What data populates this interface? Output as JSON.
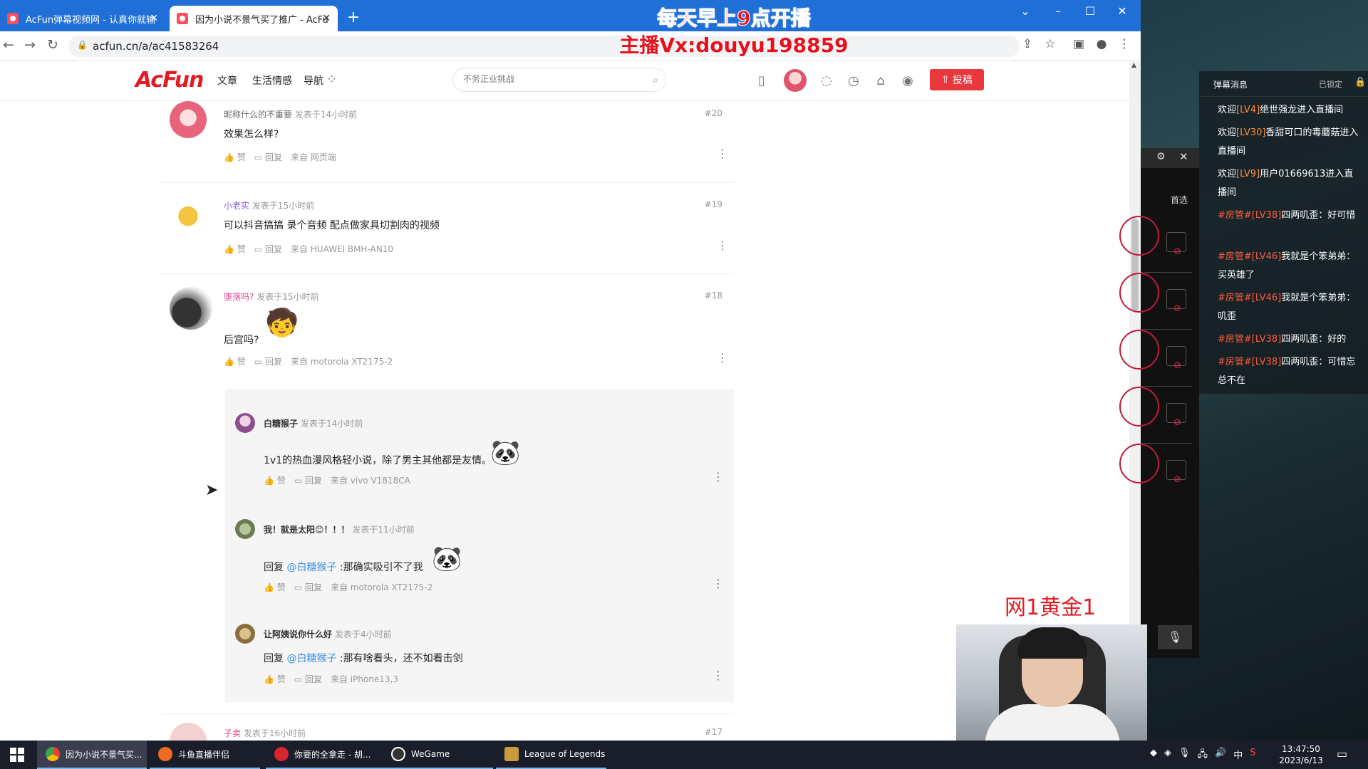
{
  "browser": {
    "tabs": [
      {
        "title": "AcFun弹幕视频网 - 认真你就输",
        "active": false
      },
      {
        "title": "因为小说不景气买了推广 - AcFu",
        "active": true
      }
    ],
    "new_tab": "+",
    "url": "acfun.cn/a/ac41583264",
    "window_controls": {
      "chevron": "⌄",
      "minimize": "–",
      "maximize": "☐",
      "close": "✕"
    }
  },
  "stream_overlay": {
    "line1": "每天早上9点开播",
    "line2": "主播Vx:douyu198859",
    "rank": "网1黄金1"
  },
  "site": {
    "logo": "AcFun",
    "nav": [
      "文章",
      "生活情感",
      "导航"
    ],
    "search_placeholder": "不务正业挑战",
    "upload_label": "投稿"
  },
  "comments": [
    {
      "name": "昵称什么的不重要",
      "time": "发表于14小时前",
      "num": "#20",
      "text": "效果怎么样?",
      "like": "赞",
      "reply": "回复",
      "source": "来自 网页端"
    },
    {
      "name": "小老实",
      "time": "发表于15小时前",
      "num": "#19",
      "text": "可以抖音搞搞  录个音频  配点做家具切割肉的视频",
      "like": "赞",
      "reply": "回复",
      "source": "来自 HUAWEI  BMH-AN10"
    },
    {
      "name": "堕落吗?",
      "time": "发表于15小时前",
      "num": "#18",
      "text": "后宫吗?",
      "like": "赞",
      "reply": "回复",
      "source": "来自 motorola  XT2175-2"
    },
    {
      "name": "子卖",
      "time": "发表于16小时前",
      "num": "#17"
    }
  ],
  "replies": [
    {
      "name": "白糖猴子",
      "time": "发表于14小时前",
      "prefix": "",
      "at": "",
      "text": "1v1的热血漫风格轻小说，除了男主其他都是友情。",
      "like": "赞",
      "reply": "回复",
      "source": "来自 vivo  V1818CA"
    },
    {
      "name": "我！就是太阳😊！！！",
      "time": "发表于11小时前",
      "prefix": "回复",
      "at": "@白糖猴子",
      "text": ":那确实吸引不了我",
      "like": "赞",
      "reply": "回复",
      "source": "来自 motorola  XT2175-2"
    },
    {
      "name": "让阿姨说你什么好",
      "time": "发表于4小时前",
      "prefix": "回复",
      "at": "@白糖猴子",
      "text": ":那有啥看头，还不如看击剑",
      "like": "赞",
      "reply": "回复",
      "source": "来自 iPhone13,3"
    }
  ],
  "danmu": {
    "title": "弹幕消息",
    "lock": "已锁定",
    "messages": [
      {
        "tag": "",
        "pre": "欢迎",
        "lv": "[LV4]",
        "text": "绝世强龙进入直播间"
      },
      {
        "tag": "",
        "pre": "欢迎",
        "lv": "[LV30]",
        "text": "香甜可口的毒蘑菇进入直播间"
      },
      {
        "tag": "",
        "pre": "欢迎",
        "lv": "[LV9]",
        "text": "用户01669613进入直播间"
      },
      {
        "tag": "#房管#",
        "pre": "",
        "lv": "[LV38]",
        "text": "四两叽歪：好可惜"
      },
      {
        "tag": "#房管#",
        "pre": "",
        "lv": "[LV46]",
        "text": "我就是个笨弟弟：买英雄了"
      },
      {
        "tag": "#房管#",
        "pre": "",
        "lv": "[LV46]",
        "text": "我就是个笨弟弟：叽歪"
      },
      {
        "tag": "#房管#",
        "pre": "",
        "lv": "[LV38]",
        "text": "四两叽歪：好的"
      },
      {
        "tag": "#房管#",
        "pre": "",
        "lv": "[LV38]",
        "text": "四两叽歪：可惜忘总不在"
      }
    ]
  },
  "obs": {
    "first_select": "首选"
  },
  "taskbar": {
    "tasks": [
      "因为小说不景气买...",
      "斗鱼直播伴侣",
      "你要的全拿走 - 胡...",
      "WeGame",
      "League of Legends"
    ],
    "tray_lang": "中",
    "time": "13:47:50",
    "date": "2023/6/13"
  },
  "colors": {
    "accent": "#e31b23",
    "chrome_blue": "#1f6fd6",
    "link": "#3a8ee6",
    "danmu_level": "#ff8a3d"
  }
}
